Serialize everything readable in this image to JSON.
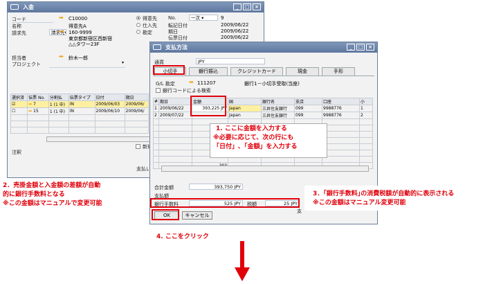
{
  "back_window": {
    "title": "入金",
    "labels": {
      "code": "コード",
      "name": "名称",
      "billing": "請求先",
      "owner": "担当者",
      "project": "プロジェクト"
    },
    "values": {
      "code": "C10000",
      "name": "得意先A",
      "billing_type": "請求先",
      "address1": "160-9999",
      "address2": "東京都新宿区西新宿",
      "address3": "△△タワー23F",
      "owner": "鈴木一郎"
    },
    "radios": {
      "customer": "得意先",
      "vendor": "仕入先",
      "account": "勘定"
    },
    "right_labels": {
      "no": "No.",
      "post_date": "転記日付",
      "due_date": "期日",
      "doc_date": "伝票日付"
    },
    "right_values": {
      "series": "一次",
      "no": "9",
      "post_date": "2009/06/22",
      "due_date": "2009/06/22",
      "doc_date": "2009/06/22"
    },
    "grid_headers": {
      "select": "選択済",
      "doc_no": "伝票 No.",
      "split": "分割払",
      "doc_type": "伝票タイプ",
      "date": "日付",
      "due": "期日"
    },
    "rows": [
      {
        "doc_no": "7",
        "split": "1 (1 中)",
        "doc_type": "IN",
        "date": "2009/06/03",
        "due": "2009/06/"
      },
      {
        "doc_no": "15",
        "split": "1 (1 中)",
        "doc_type": "IN",
        "date": "2009/06/10",
        "due": "2009/06/"
      }
    ],
    "remarks": "注釈",
    "new_label": "新規",
    "payment_label": "支払い"
  },
  "front_window": {
    "title": "支払方法",
    "currency_label": "通貨",
    "currency": "JPY",
    "tabs": [
      "小切手",
      "銀行振込",
      "クレジットカード",
      "現金",
      "手形"
    ],
    "gl_label": "G/L 勘定",
    "gl_account": "111207",
    "gl_desc": "銀行1－小切手受取(当座)",
    "bank_code_check": "銀行コードによる検索",
    "grid_headers": {
      "num": "#",
      "due": "期日",
      "amount": "金額",
      "country": "国",
      "bank": "銀行名",
      "branch": "支店",
      "account": "口座",
      "extra": "小"
    },
    "rows": [
      {
        "num": "1",
        "due": "2009/06/22",
        "amount": "393,225 JPY",
        "country": "Japan",
        "bank": "三井住友銀行",
        "branch": "099",
        "account": "9988776",
        "extra": "1"
      },
      {
        "num": "2",
        "due": "2009/07/22",
        "amount": "",
        "country": "Japan",
        "bank": "三井住友銀行",
        "branch": "099",
        "account": "9988776",
        "extra": "2"
      }
    ],
    "partial_total": "393",
    "total_label": "合計金額",
    "total_value": "393,750 JPY",
    "payment_total_label": "支払額",
    "bank_fee_label": "銀行手数料",
    "bank_fee_value": "525 JPY",
    "tax_label": "税額",
    "tax_value": "25 JPY",
    "ok": "OK",
    "cancel": "キャンセル",
    "side_label": "支"
  },
  "annotations": {
    "a1_l1": "1. ここに金額を入力する",
    "a1_l2": "※必要に応じて、次の行にも",
    "a1_l3": "「日付」､「金額」を入力する",
    "a2_l1": "2．売掛金額と入金額の差額が自動",
    "a2_l2": "的に銀行手数料となる",
    "a2_l3": "※この金額はマニュアルで変更可能",
    "a3_l1": "3．｢銀行手数料｣の消費税額が自動的に表示される",
    "a3_l2": "※この金額はマニュアル変更可能",
    "a4": "4. ここをクリック"
  },
  "colors": {
    "annotation": "#e0000a",
    "titlebar": "#5e779f",
    "highlight": "#fff0a0"
  }
}
